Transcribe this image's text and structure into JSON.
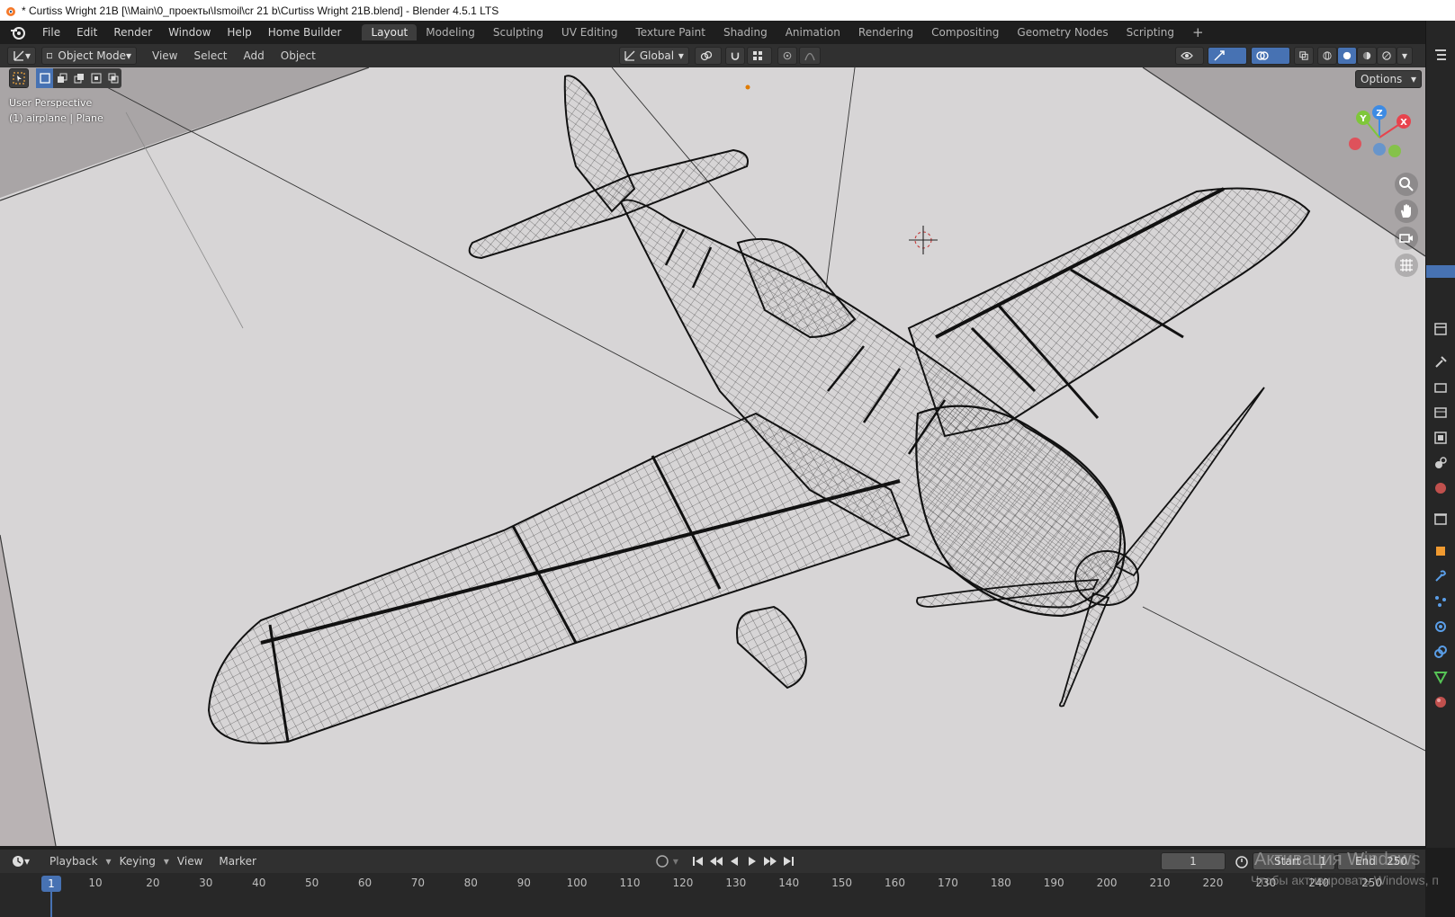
{
  "window": {
    "title": "* Curtiss Wright 21B [\\\\Main\\0_проекты\\Ismoil\\cr 21 b\\Curtiss Wright 21B.blend] - Blender 4.5.1 LTS"
  },
  "menu": [
    "File",
    "Edit",
    "Render",
    "Window",
    "Help",
    "Home Builder"
  ],
  "workspaces": [
    "Layout",
    "Modeling",
    "Sculpting",
    "UV Editing",
    "Texture Paint",
    "Shading",
    "Animation",
    "Rendering",
    "Compositing",
    "Geometry Nodes",
    "Scripting"
  ],
  "active_workspace": "Layout",
  "viewport_header": {
    "mode": "Object Mode",
    "menus": [
      "View",
      "Select",
      "Add",
      "Object"
    ],
    "transform_orientation": "Global",
    "options_label": "Options"
  },
  "viewport": {
    "view_name": "User Perspective",
    "object_info": "(1) airplane | Plane",
    "background_color": "#d7d5d6",
    "wire_color": "#1a1a1a"
  },
  "gizmo": {
    "x_label": "X",
    "y_label": "Y",
    "z_label": "Z",
    "x_color": "#e8434d",
    "y_color": "#7fc73a",
    "z_color": "#3d8be4"
  },
  "timeline": {
    "menus": [
      "Playback",
      "Keying",
      "View",
      "Marker"
    ],
    "current_frame": "1",
    "start_label": "Start",
    "start_value": "1",
    "end_label": "End",
    "end_value": "250",
    "ticks": [
      "1",
      "10",
      "20",
      "30",
      "40",
      "50",
      "60",
      "70",
      "80",
      "90",
      "100",
      "110",
      "120",
      "130",
      "140",
      "150",
      "160",
      "170",
      "180",
      "190",
      "200",
      "210",
      "220",
      "230",
      "240",
      "250"
    ]
  },
  "watermark": {
    "line1": "Активация Windows",
    "line2": "Чтобы активировать Windows, п"
  },
  "icons": [
    "blender-logo-icon",
    "select-box-icon",
    "zoom-icon",
    "hand-pan-icon",
    "camera-icon",
    "grid-icon",
    "play-icon",
    "wrench-icon"
  ]
}
